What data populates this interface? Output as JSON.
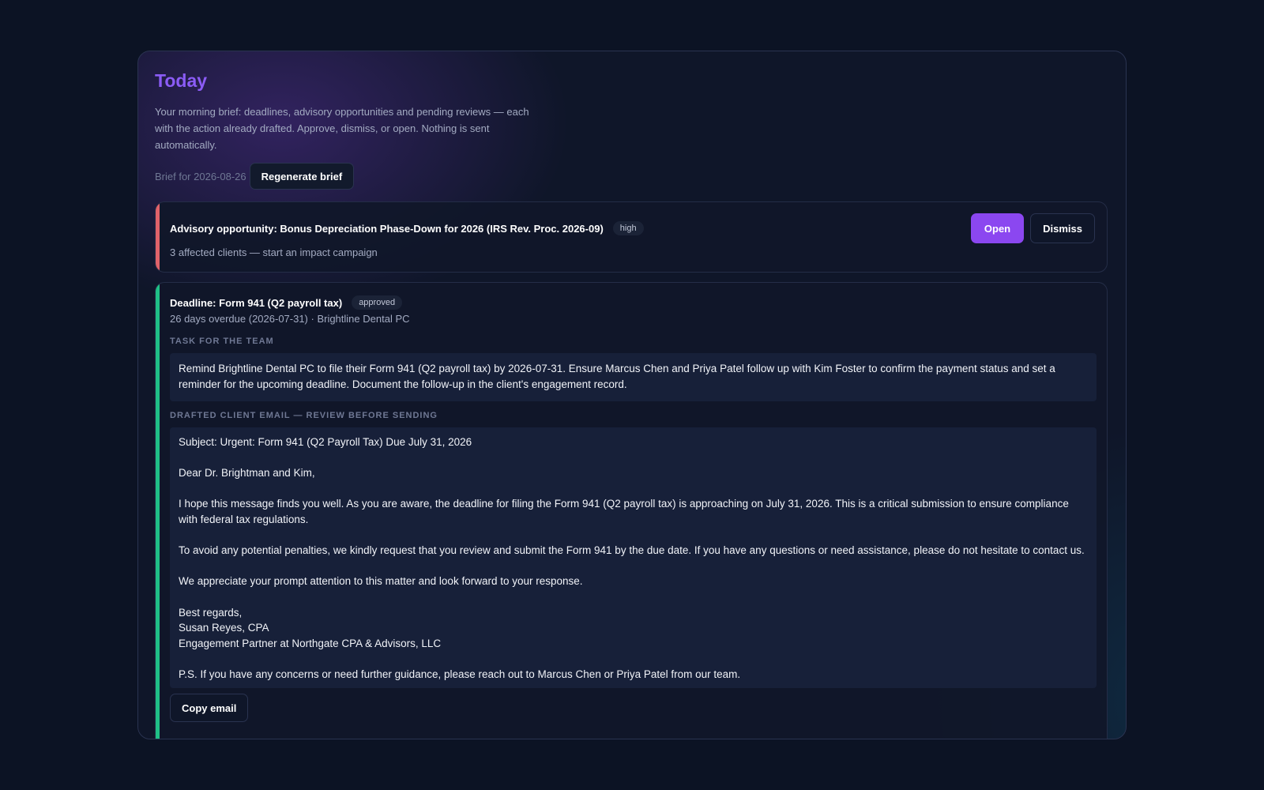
{
  "header": {
    "title": "Today",
    "intro": "Your morning brief: deadlines, advisory opportunities and pending reviews — each with the action already drafted. Approve, dismiss, or open. Nothing is sent automatically.",
    "brief_date": "Brief for 2026-08-26",
    "regenerate_label": "Regenerate brief"
  },
  "colors": {
    "accent_purple": "#8b5cf6",
    "advisory_accent": "#e0626a",
    "deadline_accent": "#1fbf86",
    "background": "#0c1324"
  },
  "cards": [
    {
      "title": "Advisory opportunity: Bonus Depreciation Phase-Down for 2026 (IRS Rev. Proc. 2026-09)",
      "badge": "high",
      "subtitle": "3 affected clients — start an impact campaign",
      "open_label": "Open",
      "dismiss_label": "Dismiss"
    },
    {
      "title": "Deadline: Form 941 (Q2 payroll tax)",
      "badge": "approved",
      "meta": "26 days overdue (2026-07-31) · Brightline Dental PC",
      "task_label": "TASK FOR THE TEAM",
      "task_text": "Remind Brightline Dental PC to file their Form 941 (Q2 payroll tax) by 2026-07-31. Ensure Marcus Chen and Priya Patel follow up with Kim Foster to confirm the payment status and set a reminder for the upcoming deadline. Document the follow-up in the client's engagement record.",
      "email_label": "DRAFTED CLIENT EMAIL — REVIEW BEFORE SENDING",
      "email": {
        "subject": "Subject: Urgent: Form 941 (Q2 Payroll Tax) Due July 31, 2026",
        "greeting": "Dear Dr. Brightman and Kim,",
        "para1": "I hope this message finds you well. As you are aware, the deadline for filing the Form 941 (Q2 payroll tax) is approaching on July 31, 2026. This is a critical submission to ensure compliance with federal tax regulations.",
        "para2": "To avoid any potential penalties, we kindly request that you review and submit the Form 941 by the due date. If you have any questions or need assistance, please do not hesitate to contact us.",
        "para3": "We appreciate your prompt attention to this matter and look forward to your response.",
        "closing": "Best regards,",
        "signer_name": "Susan Reyes, CPA",
        "signer_title": "Engagement Partner at Northgate CPA & Advisors, LLC",
        "ps": "P.S. If you have any concerns or need further guidance, please reach out to Marcus Chen or Priya Patel from our team."
      },
      "copy_label": "Copy email"
    }
  ]
}
